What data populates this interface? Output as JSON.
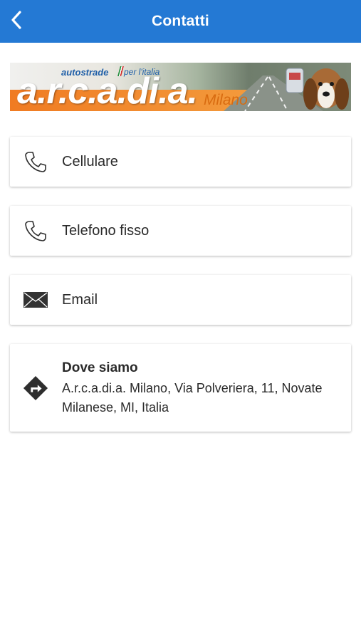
{
  "header": {
    "title": "Contatti",
    "back_icon": "chevron-left-icon",
    "background": "#2479d4"
  },
  "banner": {
    "brand_small": "autostrade",
    "brand_tagline": "per l'italia",
    "brand_main": "a.r.c.a.di.a.",
    "brand_city": "Milano"
  },
  "contacts": [
    {
      "icon": "phone-icon",
      "label": "Cellulare"
    },
    {
      "icon": "phone-icon",
      "label": "Telefono fisso"
    },
    {
      "icon": "envelope-icon",
      "label": "Email"
    }
  ],
  "location": {
    "icon": "directions-icon",
    "title": "Dove siamo",
    "address": "A.r.c.a.di.a. Milano, Via Polveriera, 11, Novate Milanese, MI, Italia"
  }
}
